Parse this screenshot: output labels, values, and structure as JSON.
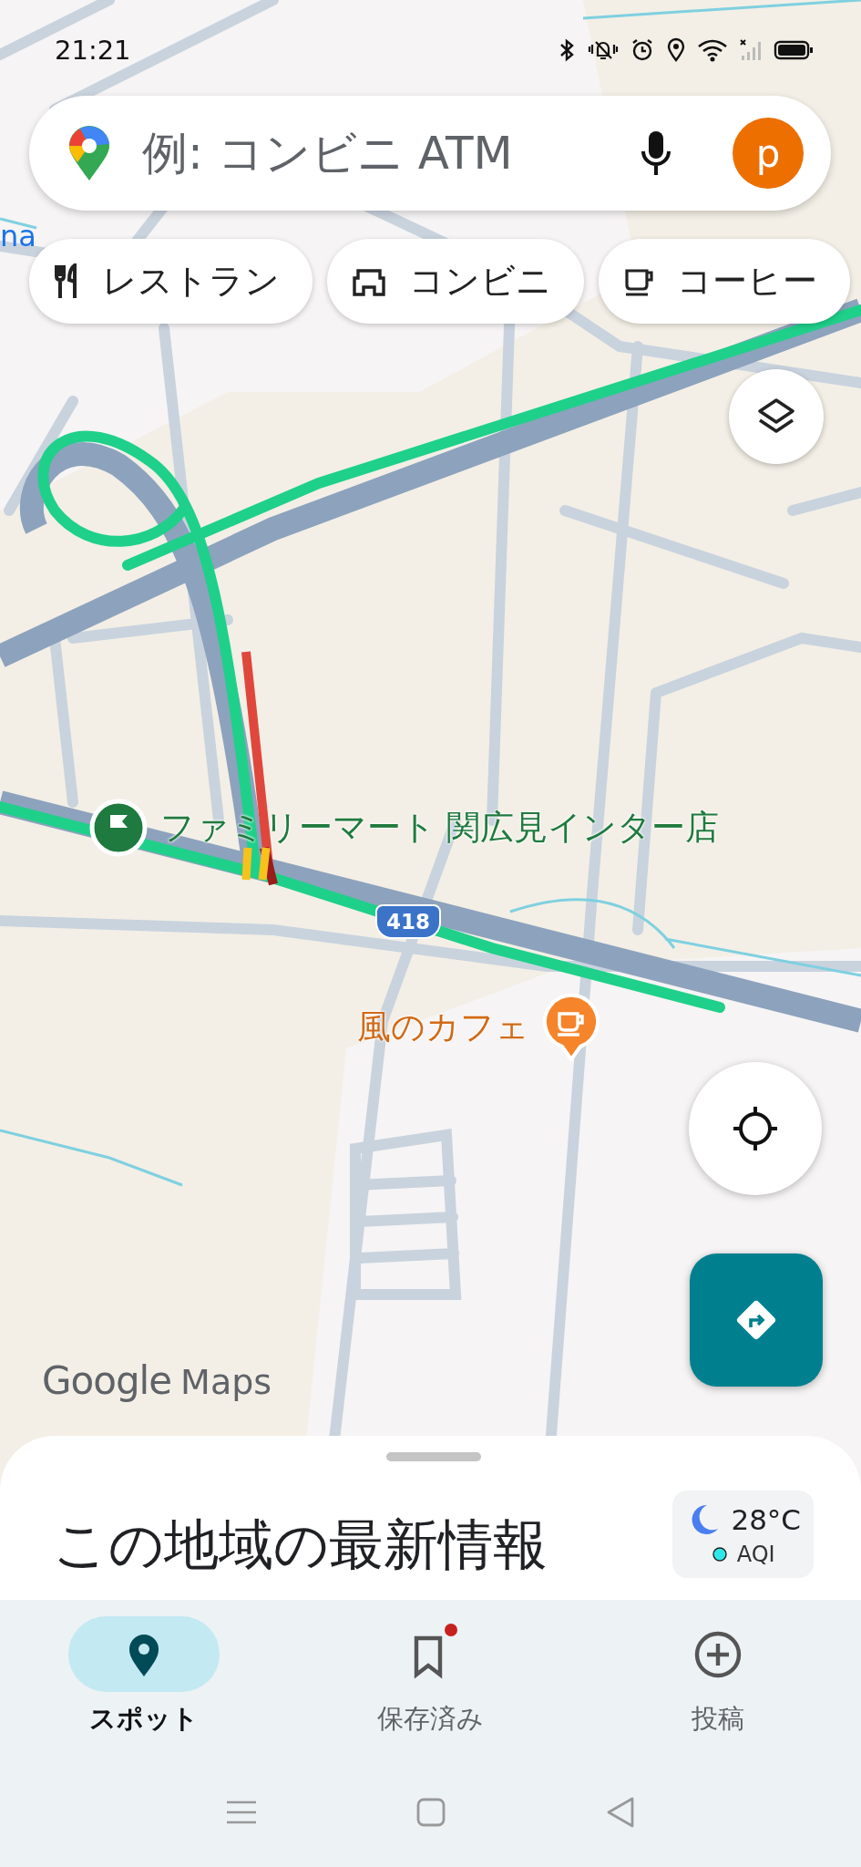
{
  "status_bar": {
    "time": "21:21"
  },
  "search": {
    "placeholder": "例: コンビニ ATM",
    "avatar_letter": "p"
  },
  "chips": [
    {
      "kind": "restaurant",
      "label": "レストラン"
    },
    {
      "kind": "store",
      "label": "コンビニ"
    },
    {
      "kind": "coffee",
      "label": "コーヒー"
    }
  ],
  "map": {
    "edge_label": "na",
    "route_shield": "418",
    "places": [
      {
        "kind": "store",
        "name": "ファミリーマート 関広見インター店"
      },
      {
        "kind": "cafe",
        "name": "風のカフェ"
      }
    ],
    "logo": {
      "word_1": "Google",
      "word_2": "Maps"
    }
  },
  "sheet": {
    "title": "この地域の最新情報",
    "weather": {
      "temperature": "28°C",
      "air_quality": "AQI"
    }
  },
  "nav_tabs": [
    {
      "kind": "explore",
      "label": "スポット",
      "selected": true
    },
    {
      "kind": "saved",
      "label": "保存済み",
      "selected": false,
      "badge": true
    },
    {
      "kind": "contribute",
      "label": "投稿",
      "selected": false
    }
  ]
}
